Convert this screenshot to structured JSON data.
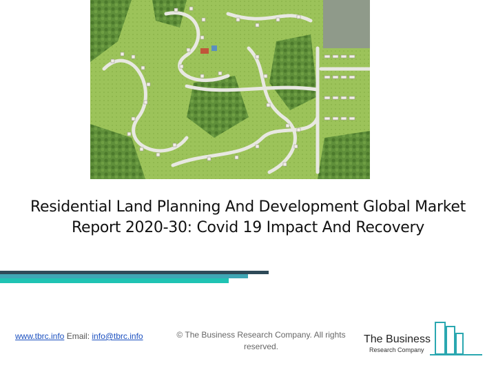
{
  "title": {
    "line1": "Residential Land Planning And Development Global Market",
    "line2": "Report 2020-30: Covid 19 Impact And Recovery"
  },
  "hero_image": {
    "icon": "site-plan-aerial-map"
  },
  "footer": {
    "website": "www.tbrc.info",
    "email_label": "Email:",
    "email": "info@tbrc.info",
    "copyright_line1": "© The Business Research Company. All rights",
    "copyright_line2": "reserved."
  },
  "logo": {
    "name": "The Business",
    "sub": "Research Company"
  },
  "colors": {
    "bar_dark": "#2e4a58",
    "bar_mid": "#3fa6b5",
    "bar_light": "#1fc3b3",
    "link": "#1a4fbf",
    "logo_accent": "#2aa7b0"
  }
}
